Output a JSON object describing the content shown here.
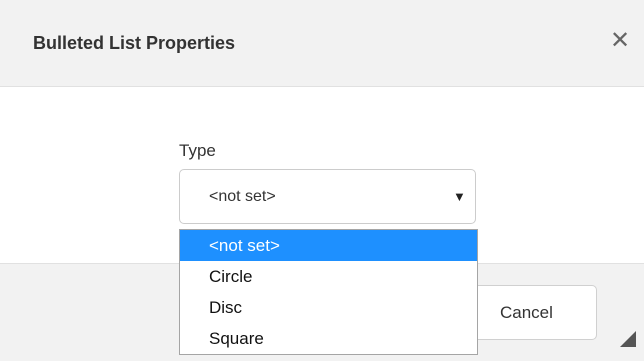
{
  "dialog": {
    "title": "Bulleted List Properties",
    "close_icon": "close-icon",
    "close_glyph": "✕"
  },
  "type_field": {
    "label": "Type",
    "selected_value": "<not set>",
    "arrow_glyph": "▼",
    "options": [
      "<not set>",
      "Circle",
      "Disc",
      "Square"
    ],
    "highlighted_option": "<not set>"
  },
  "footer": {
    "cancel_label": "Cancel"
  },
  "colors": {
    "highlight": "#1e90ff",
    "header_bg": "#f2f2f2"
  }
}
